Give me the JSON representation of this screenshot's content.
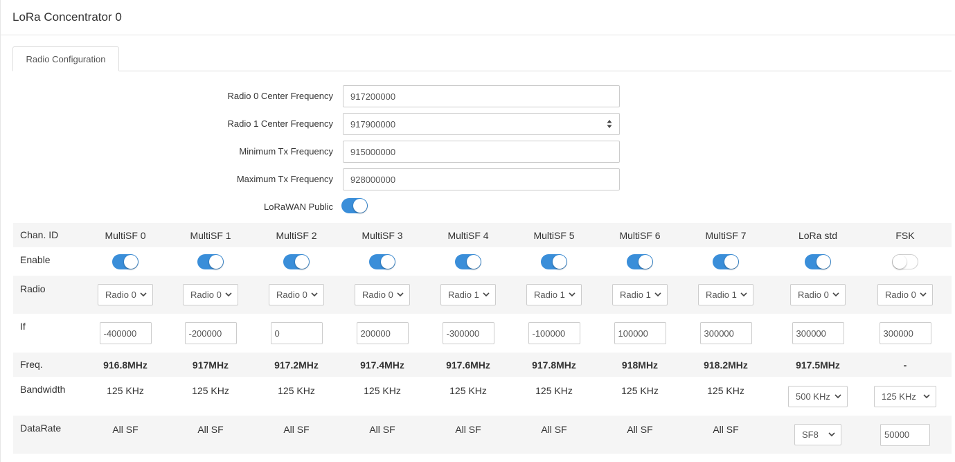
{
  "page": {
    "title": "LoRa Concentrator 0"
  },
  "tabs": [
    {
      "label": "Radio Configuration"
    }
  ],
  "radio_form": {
    "radio0_center": {
      "label": "Radio 0 Center Frequency",
      "value": "917200000"
    },
    "radio1_center": {
      "label": "Radio 1 Center Frequency",
      "value": "917900000"
    },
    "min_tx": {
      "label": "Minimum Tx Frequency",
      "value": "915000000"
    },
    "max_tx": {
      "label": "Maximum Tx Frequency",
      "value": "928000000"
    },
    "lorawan_public": {
      "label": "LoRaWAN Public",
      "enabled": true
    }
  },
  "channels": {
    "row_labels": {
      "chan_id": "Chan. ID",
      "enable": "Enable",
      "radio": "Radio",
      "if": "If",
      "freq": "Freq.",
      "bandwidth": "Bandwidth",
      "datarate": "DataRate"
    },
    "columns": [
      {
        "id": "MultiSF 0",
        "enabled": true,
        "radio": "Radio 0",
        "if": "-400000",
        "freq": "916.8MHz",
        "bandwidth": "125 KHz",
        "datarate": "All SF"
      },
      {
        "id": "MultiSF 1",
        "enabled": true,
        "radio": "Radio 0",
        "if": "-200000",
        "freq": "917MHz",
        "bandwidth": "125 KHz",
        "datarate": "All SF"
      },
      {
        "id": "MultiSF 2",
        "enabled": true,
        "radio": "Radio 0",
        "if": "0",
        "freq": "917.2MHz",
        "bandwidth": "125 KHz",
        "datarate": "All SF"
      },
      {
        "id": "MultiSF 3",
        "enabled": true,
        "radio": "Radio 0",
        "if": "200000",
        "freq": "917.4MHz",
        "bandwidth": "125 KHz",
        "datarate": "All SF"
      },
      {
        "id": "MultiSF 4",
        "enabled": true,
        "radio": "Radio 1",
        "if": "-300000",
        "freq": "917.6MHz",
        "bandwidth": "125 KHz",
        "datarate": "All SF"
      },
      {
        "id": "MultiSF 5",
        "enabled": true,
        "radio": "Radio 1",
        "if": "-100000",
        "freq": "917.8MHz",
        "bandwidth": "125 KHz",
        "datarate": "All SF"
      },
      {
        "id": "MultiSF 6",
        "enabled": true,
        "radio": "Radio 1",
        "if": "100000",
        "freq": "918MHz",
        "bandwidth": "125 KHz",
        "datarate": "All SF"
      },
      {
        "id": "MultiSF 7",
        "enabled": true,
        "radio": "Radio 1",
        "if": "300000",
        "freq": "918.2MHz",
        "bandwidth": "125 KHz",
        "datarate": "All SF"
      },
      {
        "id": "LoRa std",
        "enabled": true,
        "radio": "Radio 0",
        "if": "300000",
        "freq": "917.5MHz",
        "bandwidth_select": "500 KHz",
        "datarate_select": "SF8"
      },
      {
        "id": "FSK",
        "enabled": false,
        "radio": "Radio 0",
        "if": "300000",
        "freq": "-",
        "bandwidth_select": "125 KHz",
        "datarate_input": "50000"
      }
    ]
  },
  "colors": {
    "accent": "#3a8ed9",
    "row_shade": "#f5f5f5",
    "border": "#cccccc"
  },
  "icons": {
    "select_chevron": "chevron-down-icon",
    "spinner": "spin-arrows-icon"
  }
}
